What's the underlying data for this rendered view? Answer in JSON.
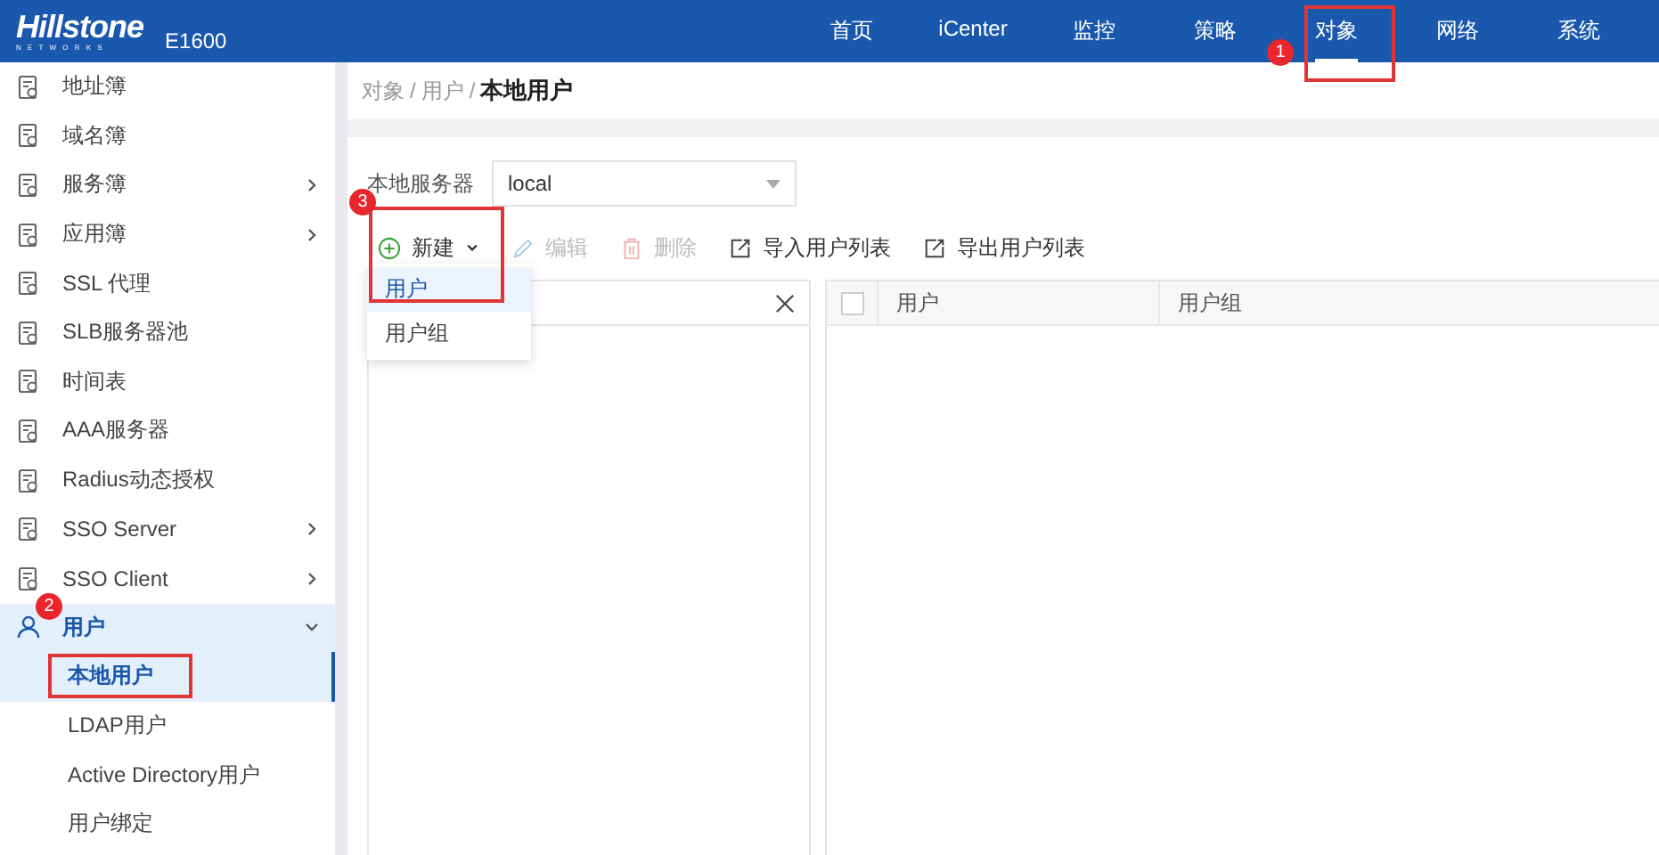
{
  "header": {
    "logo": "Hillstone",
    "logo_sub": "NETWORKS",
    "model": "E1600",
    "nav": [
      {
        "label": "首页",
        "selected": false,
        "highlighted": false
      },
      {
        "label": "iCenter",
        "selected": false,
        "highlighted": false
      },
      {
        "label": "监控",
        "selected": false,
        "highlighted": false
      },
      {
        "label": "策略",
        "selected": false,
        "highlighted": false
      },
      {
        "label": "对象",
        "selected": true,
        "highlighted": true,
        "badge": "1"
      },
      {
        "label": "网络",
        "selected": false,
        "highlighted": false
      },
      {
        "label": "系统",
        "selected": false,
        "highlighted": false
      }
    ]
  },
  "sidebar": {
    "items": [
      {
        "label": "地址簿",
        "expandable": false,
        "selected": false
      },
      {
        "label": "域名簿",
        "expandable": false,
        "selected": false
      },
      {
        "label": "服务簿",
        "expandable": true,
        "expanded": false,
        "selected": false
      },
      {
        "label": "应用簿",
        "expandable": true,
        "expanded": false,
        "selected": false
      },
      {
        "label": "SSL 代理",
        "expandable": false,
        "selected": false
      },
      {
        "label": "SLB服务器池",
        "expandable": false,
        "selected": false
      },
      {
        "label": "时间表",
        "expandable": false,
        "selected": false
      },
      {
        "label": "AAA服务器",
        "expandable": false,
        "selected": false
      },
      {
        "label": "Radius动态授权",
        "expandable": false,
        "selected": false
      },
      {
        "label": "SSO Server",
        "expandable": true,
        "expanded": false,
        "selected": false
      },
      {
        "label": "SSO Client",
        "expandable": true,
        "expanded": false,
        "selected": false
      },
      {
        "label": "用户",
        "expandable": true,
        "expanded": true,
        "selected": true,
        "badge": "2",
        "children": [
          {
            "label": "本地用户",
            "selected": true,
            "highlighted": true
          },
          {
            "label": "LDAP用户",
            "selected": false,
            "highlighted": false
          },
          {
            "label": "Active Directory用户",
            "selected": false,
            "highlighted": false
          },
          {
            "label": "用户绑定",
            "selected": false,
            "highlighted": false
          }
        ]
      }
    ]
  },
  "breadcrumb": {
    "separator": "/",
    "items": [
      "对象",
      "用户",
      "本地用户"
    ]
  },
  "server_field": {
    "label": "本地服务器",
    "value": "local"
  },
  "toolbar": [
    {
      "label": "新建",
      "kind": "new",
      "disabled": false,
      "highlighted": true,
      "badge": "3"
    },
    {
      "label": "编辑",
      "kind": "edit",
      "disabled": true,
      "highlighted": false
    },
    {
      "label": "删除",
      "kind": "delete",
      "disabled": true,
      "highlighted": false
    },
    {
      "label": "导入用户列表",
      "kind": "import",
      "disabled": false,
      "highlighted": false
    },
    {
      "label": "导出用户列表",
      "kind": "export",
      "disabled": false,
      "highlighted": false
    }
  ],
  "new_menu": [
    {
      "label": "用户",
      "selected": true
    },
    {
      "label": "用户组",
      "selected": false
    }
  ],
  "table": {
    "checked": false,
    "columns": [
      "用户",
      "用户组"
    ]
  }
}
